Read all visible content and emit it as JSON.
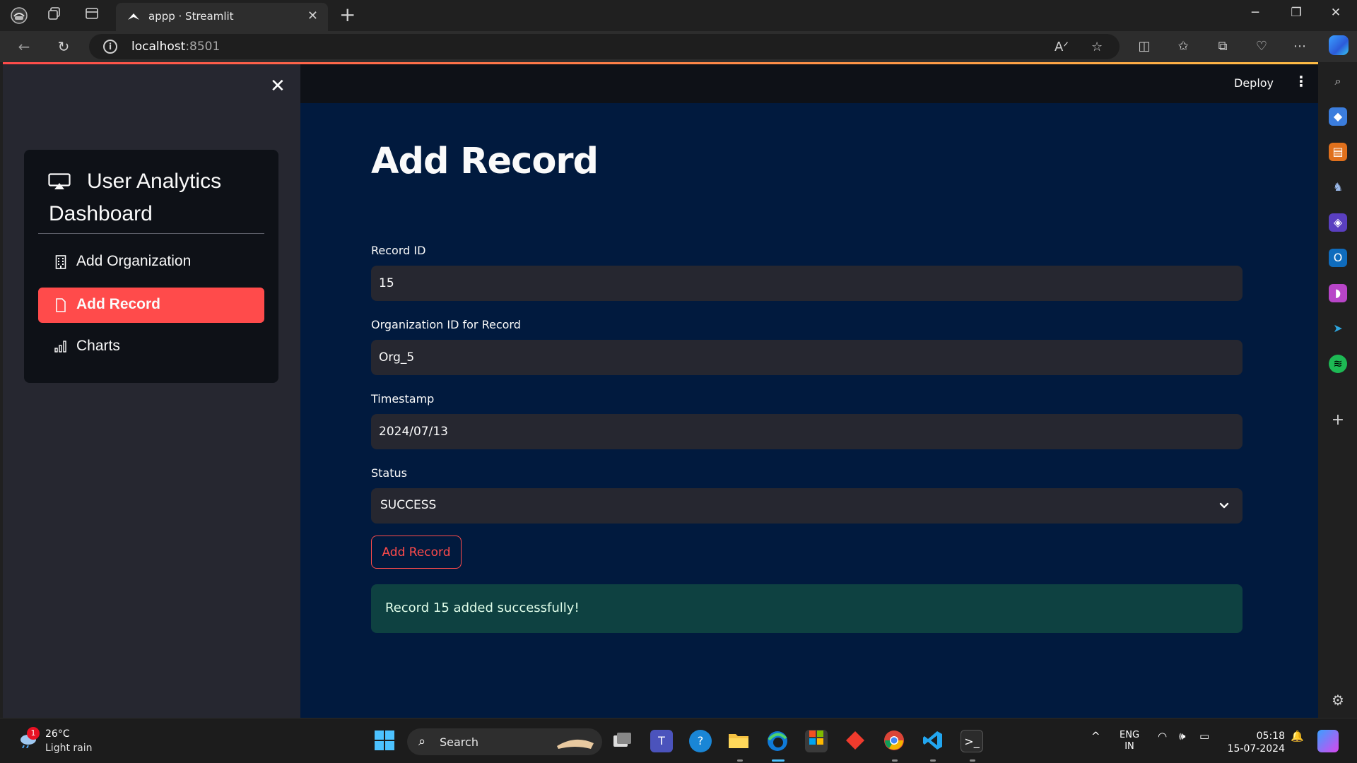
{
  "browser": {
    "tab_title": "appp · Streamlit",
    "url_host": "localhost",
    "url_port": ":8501"
  },
  "sidebar": {
    "app_title": "User Analytics Dashboard",
    "items": [
      {
        "label": "Add Organization",
        "icon": "building-icon",
        "active": false
      },
      {
        "label": "Add Record",
        "icon": "file-icon",
        "active": true
      },
      {
        "label": "Charts",
        "icon": "bar-chart-icon",
        "active": false
      }
    ]
  },
  "header": {
    "deploy_label": "Deploy"
  },
  "main": {
    "title": "Add Record",
    "fields": [
      {
        "label": "Record ID",
        "value": "15"
      },
      {
        "label": "Organization ID for Record",
        "value": "Org_5"
      },
      {
        "label": "Timestamp",
        "value": "2024/07/13"
      }
    ],
    "status": {
      "label": "Status",
      "value": "SUCCESS"
    },
    "submit_label": "Add Record",
    "success_message": "Record 15 added successfully!"
  },
  "taskbar": {
    "weather_temp": "26°C",
    "weather_cond": "Light rain",
    "weather_badge": "1",
    "search_label": "Search",
    "lang_top": "ENG",
    "lang_bottom": "IN",
    "time": "05:18",
    "date": "15-07-2024"
  },
  "colors": {
    "accent": "#ff4b4b",
    "main_bg": "#011a3e",
    "sidebar_bg": "#262730",
    "success_bg": "#0e4141"
  }
}
